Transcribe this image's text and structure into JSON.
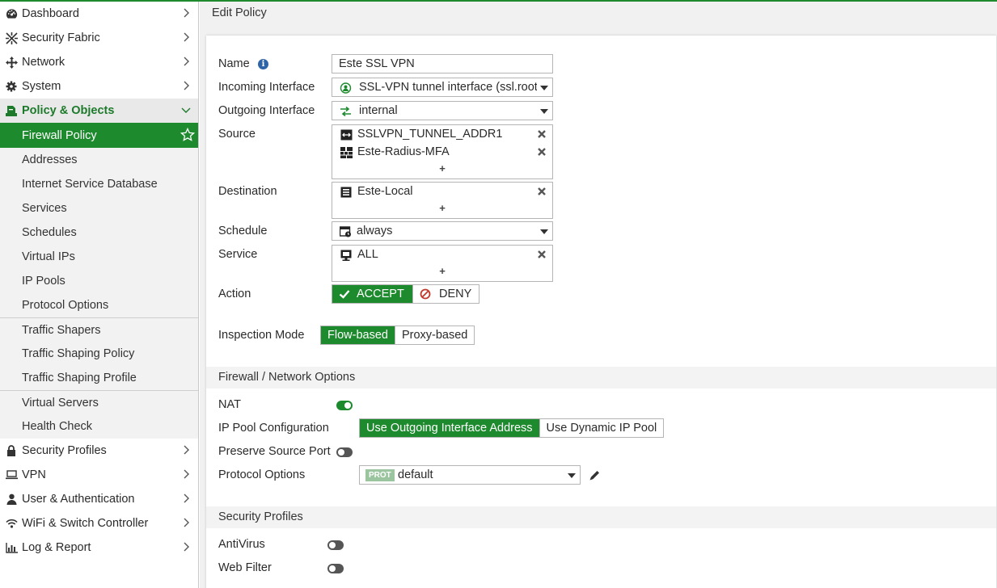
{
  "sidebar": {
    "top_items": [
      {
        "label": "Dashboard",
        "icon": "dashboard-icon"
      },
      {
        "label": "Security Fabric",
        "icon": "security-fabric-icon"
      },
      {
        "label": "Network",
        "icon": "network-icon"
      },
      {
        "label": "System",
        "icon": "gear-icon"
      }
    ],
    "active_parent": {
      "label": "Policy & Objects",
      "icon": "policy-icon"
    },
    "sub_items": [
      "Firewall Policy",
      "Addresses",
      "Internet Service Database",
      "Services",
      "Schedules",
      "Virtual IPs",
      "IP Pools",
      "Protocol Options",
      "Traffic Shapers",
      "Traffic Shaping Policy",
      "Traffic Shaping Profile",
      "Virtual Servers",
      "Health Check"
    ],
    "bottom_items": [
      {
        "label": "Security Profiles",
        "icon": "lock-icon"
      },
      {
        "label": "VPN",
        "icon": "laptop-icon"
      },
      {
        "label": "User & Authentication",
        "icon": "user-icon"
      },
      {
        "label": "WiFi & Switch Controller",
        "icon": "wifi-icon"
      },
      {
        "label": "Log & Report",
        "icon": "bar-chart-icon"
      }
    ]
  },
  "page": {
    "title": "Edit Policy"
  },
  "form": {
    "name_label": "Name",
    "name_value": "Este SSL VPN",
    "incoming_label": "Incoming Interface",
    "incoming_value": "SSL-VPN tunnel interface (ssl.root)",
    "outgoing_label": "Outgoing Interface",
    "outgoing_value": "internal",
    "source_label": "Source",
    "source_entries": [
      "SSLVPN_TUNNEL_ADDR1",
      "Este-Radius-MFA"
    ],
    "destination_label": "Destination",
    "destination_entries": [
      "Este-Local"
    ],
    "schedule_label": "Schedule",
    "schedule_value": "always",
    "service_label": "Service",
    "service_entries": [
      "ALL"
    ],
    "add_symbol": "+",
    "action_label": "Action",
    "action_accept": "ACCEPT",
    "action_deny": "DENY",
    "inspection_label": "Inspection Mode",
    "inspection_flow": "Flow-based",
    "inspection_proxy": "Proxy-based"
  },
  "firewall_section": {
    "title": "Firewall / Network Options",
    "nat_label": "NAT",
    "nat_enabled": true,
    "ippool_label": "IP Pool Configuration",
    "ippool_outgoing": "Use Outgoing Interface Address",
    "ippool_dynamic": "Use Dynamic IP Pool",
    "preserve_label": "Preserve Source Port",
    "preserve_enabled": false,
    "protocol_label": "Protocol Options",
    "protocol_badge": "PROT",
    "protocol_value": "default"
  },
  "security_section": {
    "title": "Security Profiles",
    "antivirus_label": "AntiVirus",
    "antivirus_enabled": false,
    "webfilter_label": "Web Filter",
    "webfilter_enabled": false
  },
  "colors": {
    "accent": "#1e8a2e",
    "info": "#2f64a8",
    "deny": "#c0392b"
  }
}
